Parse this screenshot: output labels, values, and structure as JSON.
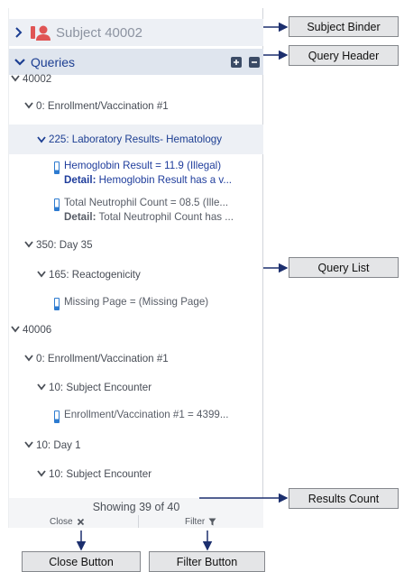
{
  "binder": {
    "label": "Subject 40002"
  },
  "queries_header": {
    "label": "Queries"
  },
  "tree": [
    {
      "label": "40002"
    },
    {
      "label": "0: Enrollment/Vaccination #1"
    },
    {
      "label": "225: Laboratory Results- Hematology"
    },
    {
      "label": "350: Day 35"
    },
    {
      "label": "165: Reactogenicity"
    },
    {
      "label": "40006"
    },
    {
      "label": "0: Enrollment/Vaccination #1"
    },
    {
      "label": "10: Subject Encounter"
    },
    {
      "label": "10: Day 1"
    },
    {
      "label": "10: Subject Encounter"
    }
  ],
  "queries": [
    {
      "title": "Hemoglobin Result = 11.9 (Illegal)",
      "detail_label": "Detail:",
      "detail": " Hemoglobin Result has a v..."
    },
    {
      "title": "Total Neutrophil Count = 08.5 (Ille...",
      "detail_label": "Detail:",
      "detail": " Total Neutrophil Count has ..."
    },
    {
      "title": "Missing Page = (Missing Page)"
    },
    {
      "title": "Enrollment/Vaccination #1 = 4399..."
    }
  ],
  "footer": {
    "showing": "Showing 39 of 40",
    "close": "Close",
    "filter": "Filter"
  },
  "callouts": {
    "subject_binder": "Subject Binder",
    "query_header": "Query Header",
    "query_list": "Query List",
    "results_count": "Results Count",
    "close_button": "Close Button",
    "filter_button": "Filter Button"
  },
  "colors": {
    "accent_blue": "#1c3e92",
    "binder_red": "#e05555",
    "header_bg": "#dfe5ee",
    "selected_bg": "#edf0f5"
  }
}
